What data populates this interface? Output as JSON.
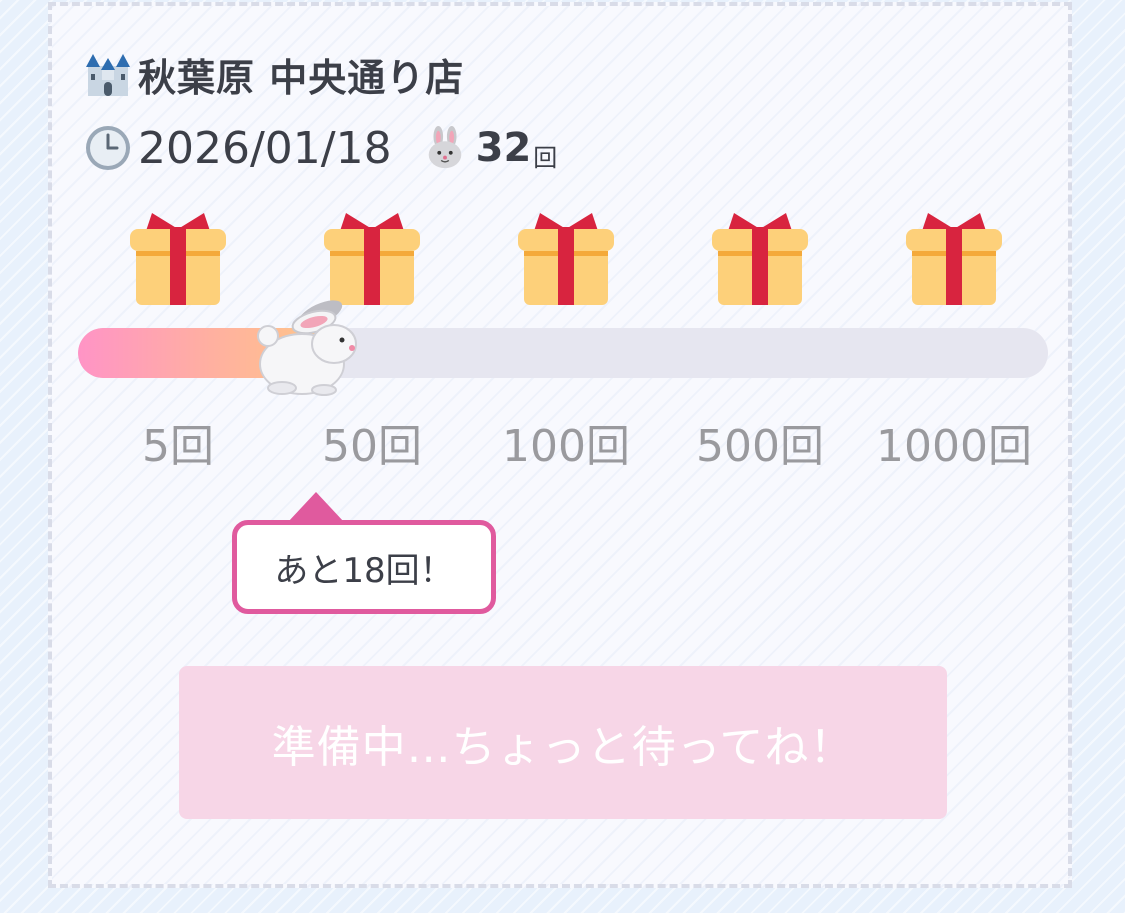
{
  "store": {
    "icon": "castle-icon",
    "name": "秋葉原 中央通り店"
  },
  "visit": {
    "date_icon": "clock-icon",
    "date": "2026/01/18",
    "count_icon": "rabbit-face-icon",
    "count": "32",
    "count_unit": "回"
  },
  "progress": {
    "current": 32,
    "fill_fraction": 0.25,
    "runner_icon": "rabbit-icon",
    "milestones": [
      {
        "label": "5回",
        "icon": "gift-icon"
      },
      {
        "label": "50回",
        "icon": "gift-icon"
      },
      {
        "label": "100回",
        "icon": "gift-icon"
      },
      {
        "label": "500回",
        "icon": "gift-icon"
      },
      {
        "label": "1000回",
        "icon": "gift-icon"
      }
    ]
  },
  "tooltip": {
    "text": "あと18回！"
  },
  "action": {
    "label": "準備中…ちょっと待ってね！",
    "disabled": true
  },
  "colors": {
    "accent_pink": "#e05a9e",
    "button_bg": "#f7d6e7",
    "track": "#e6e6f0"
  }
}
